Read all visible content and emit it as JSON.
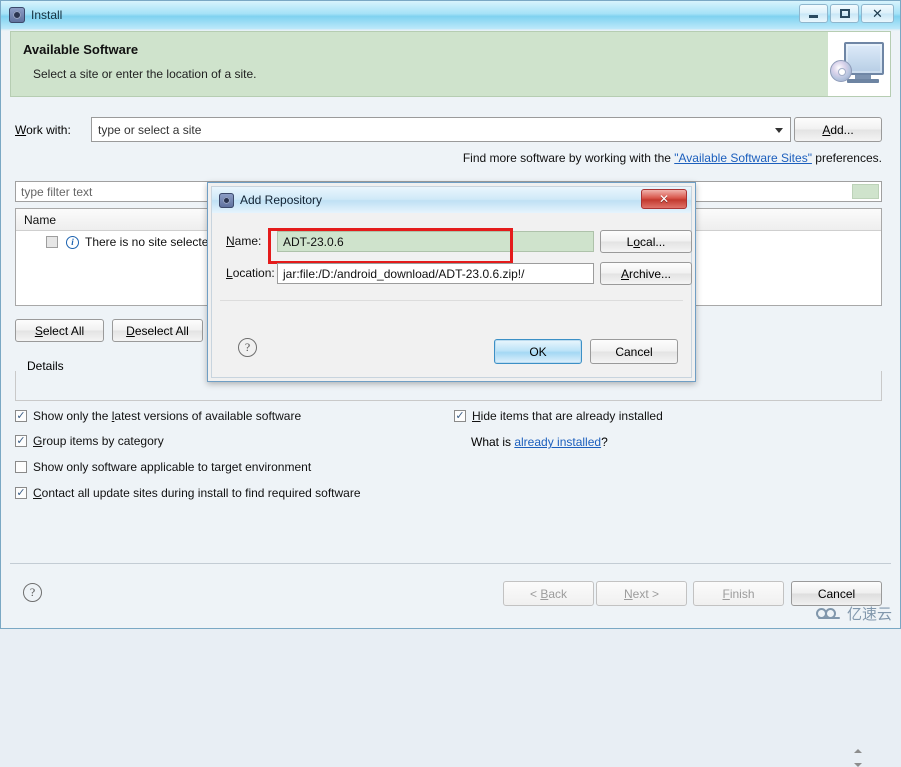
{
  "window": {
    "title": "Install",
    "icon": "eclipse-gear-icon",
    "controls": {
      "minimize": "minimize-icon",
      "maximize": "maximize-icon",
      "close": "✕"
    }
  },
  "banner": {
    "title": "Available Software",
    "subtitle": "Select a site or enter the location of a site.",
    "art": "monitor-cd-icon"
  },
  "work_with": {
    "label": "Work with:",
    "value": "type or select a site",
    "add_button": "Add..."
  },
  "find_more": {
    "prefix": "Find more software by working with the ",
    "link": "\"Available Software Sites\"",
    "suffix": " preferences."
  },
  "filter": {
    "placeholder": "type filter text"
  },
  "table": {
    "columns": [
      "Name"
    ],
    "rows": [
      {
        "checked": false,
        "icon": "info-icon",
        "text": "There is no site selected"
      }
    ]
  },
  "list_buttons": {
    "select_all": "Select All",
    "deselect_all": "Deselect All"
  },
  "details": {
    "label": "Details",
    "value": ""
  },
  "options": {
    "left": [
      {
        "label_pre": "Show only the ",
        "label_key": "l",
        "label_post": "atest versions of available software",
        "checked": true
      },
      {
        "label_pre": "",
        "label_key": "G",
        "label_post": "roup items by category",
        "checked": true
      },
      {
        "label_pre": "Show only software applicable to target environment",
        "label_key": "",
        "label_post": "",
        "checked": false
      },
      {
        "label_pre": "",
        "label_key": "C",
        "label_post": "ontact all update sites during install to find required software",
        "checked": true
      }
    ],
    "right": [
      {
        "label_pre": "",
        "label_key": "H",
        "label_post": "ide items that are already installed",
        "checked": true
      }
    ],
    "what_is_prefix": "What is ",
    "what_is_link": "already installed",
    "what_is_suffix": "?"
  },
  "footer": {
    "help": "?",
    "back": "< Back",
    "next": "Next >",
    "finish": "Finish",
    "cancel": "Cancel"
  },
  "modal": {
    "title": "Add Repository",
    "icon": "eclipse-gear-icon",
    "close": "✕",
    "name_label": "Name:",
    "name_value": "ADT-23.0.6",
    "location_label": "Location:",
    "location_value": "jar:file:/D:/android_download/ADT-23.0.6.zip!/",
    "local_button": "Local...",
    "archive_button": "Archive...",
    "help": "?",
    "ok": "OK",
    "cancel": "Cancel",
    "highlight_color": "#e41b1b"
  },
  "watermark": {
    "text": "亿速云",
    "logo": "cloud-eyes-logo"
  }
}
